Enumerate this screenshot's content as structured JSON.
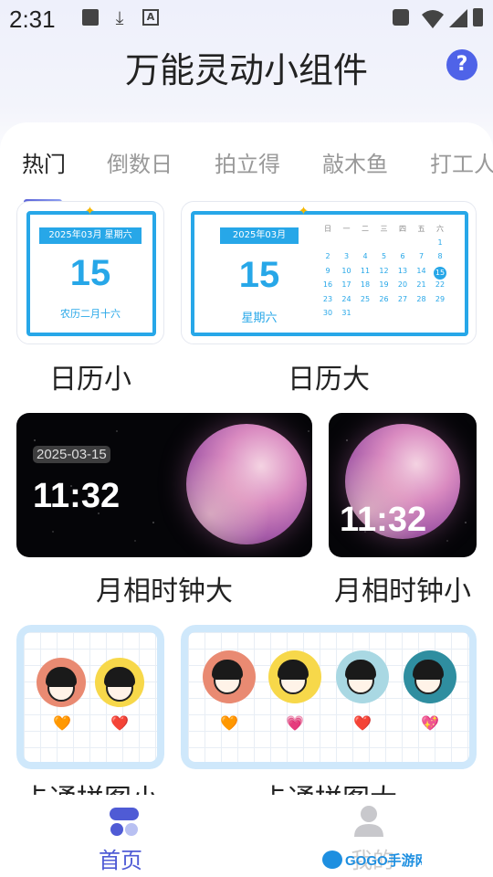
{
  "status_bar": {
    "time": "2:31"
  },
  "header": {
    "title": "万能灵动小组件",
    "help_label": "?"
  },
  "tabs": [
    {
      "label": "热门",
      "active": true
    },
    {
      "label": "倒数日",
      "active": false
    },
    {
      "label": "拍立得",
      "active": false
    },
    {
      "label": "敲木鱼",
      "active": false
    },
    {
      "label": "打工人",
      "active": false
    }
  ],
  "widgets": {
    "calendar_small": {
      "label": "日历小",
      "header": "2025年03月 星期六",
      "day": "15",
      "lunar": "农历二月十六"
    },
    "calendar_large": {
      "label": "日历大",
      "header": "2025年03月",
      "day": "15",
      "weekday": "星期六",
      "weekdays": [
        "日",
        "一",
        "二",
        "三",
        "四",
        "五",
        "六"
      ],
      "weeks": [
        [
          "",
          "",
          "",
          "",
          "",
          "",
          "1"
        ],
        [
          "2",
          "3",
          "4",
          "5",
          "6",
          "7",
          "8"
        ],
        [
          "9",
          "10",
          "11",
          "12",
          "13",
          "14",
          "15"
        ],
        [
          "16",
          "17",
          "18",
          "19",
          "20",
          "21",
          "22"
        ],
        [
          "23",
          "24",
          "25",
          "26",
          "27",
          "28",
          "29"
        ],
        [
          "30",
          "31",
          "",
          "",
          "",
          "",
          ""
        ]
      ],
      "today": "15"
    },
    "moon_large": {
      "label": "月相时钟大",
      "date": "2025-03-15",
      "time": "11:32"
    },
    "moon_small": {
      "label": "月相时钟小",
      "time": "11:32"
    },
    "cartoon_small": {
      "label": "卡通拼图小",
      "hearts": [
        "🧡",
        "❤️"
      ]
    },
    "cartoon_large": {
      "label": "卡通拼图大",
      "hearts": [
        "🧡",
        "💗",
        "❤️",
        "💖"
      ]
    }
  },
  "bottom_nav": [
    {
      "label": "首页",
      "active": true
    },
    {
      "label": "我的",
      "active": false
    }
  ],
  "watermark": {
    "text": "GOGO手游网"
  },
  "colors": {
    "accent": "#4f5bd5",
    "calendar_blue": "#27a7e8",
    "help_button": "#4f63e8"
  }
}
